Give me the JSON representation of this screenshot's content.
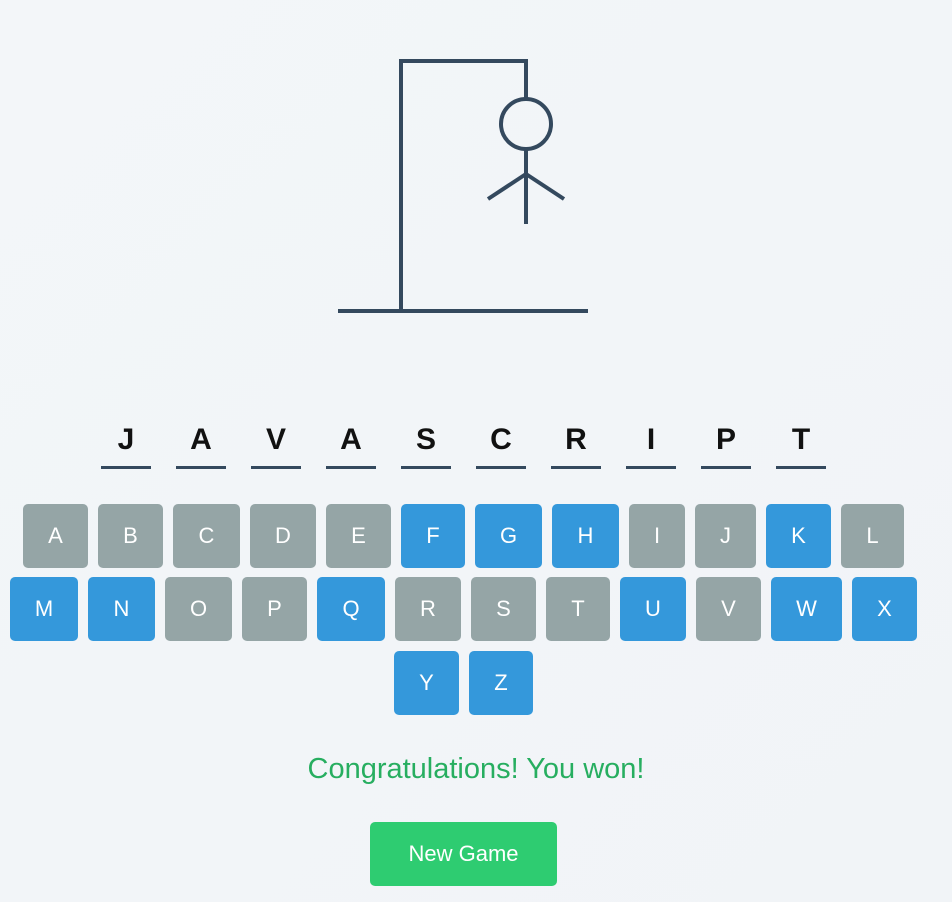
{
  "game": {
    "word_letters": [
      "J",
      "A",
      "V",
      "A",
      "S",
      "C",
      "R",
      "I",
      "P",
      "T"
    ],
    "message": "Congratulations! You won!",
    "new_game_label": "New Game"
  },
  "keyboard": {
    "keys": [
      {
        "letter": "A",
        "state": "used"
      },
      {
        "letter": "B",
        "state": "used"
      },
      {
        "letter": "C",
        "state": "used"
      },
      {
        "letter": "D",
        "state": "used"
      },
      {
        "letter": "E",
        "state": "used"
      },
      {
        "letter": "F",
        "state": "available"
      },
      {
        "letter": "G",
        "state": "available"
      },
      {
        "letter": "H",
        "state": "available"
      },
      {
        "letter": "I",
        "state": "used"
      },
      {
        "letter": "J",
        "state": "used"
      },
      {
        "letter": "K",
        "state": "available"
      },
      {
        "letter": "L",
        "state": "used"
      },
      {
        "letter": "M",
        "state": "available"
      },
      {
        "letter": "N",
        "state": "available"
      },
      {
        "letter": "O",
        "state": "used"
      },
      {
        "letter": "P",
        "state": "used"
      },
      {
        "letter": "Q",
        "state": "available"
      },
      {
        "letter": "R",
        "state": "used"
      },
      {
        "letter": "S",
        "state": "used"
      },
      {
        "letter": "T",
        "state": "used"
      },
      {
        "letter": "U",
        "state": "available"
      },
      {
        "letter": "V",
        "state": "used"
      },
      {
        "letter": "W",
        "state": "available"
      },
      {
        "letter": "X",
        "state": "available"
      },
      {
        "letter": "Y",
        "state": "available"
      },
      {
        "letter": "Z",
        "state": "available"
      }
    ]
  },
  "colors": {
    "used_key": "#95a5a6",
    "available_key": "#3498db",
    "win_message": "#27ae60",
    "new_game_button": "#2ecc71",
    "drawing_stroke": "#34495e"
  }
}
